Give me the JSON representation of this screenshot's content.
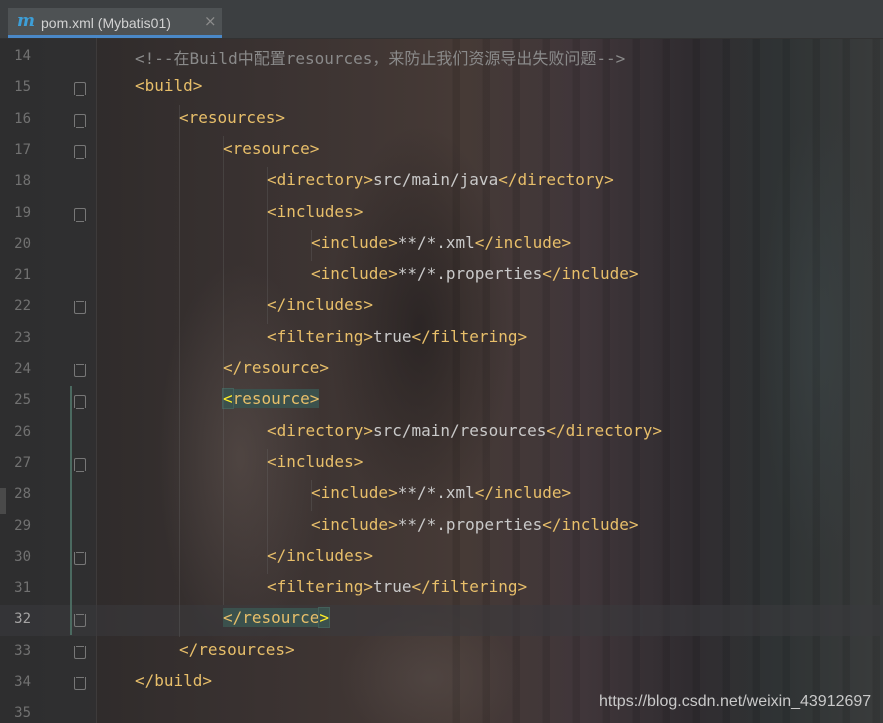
{
  "tab": {
    "icon": "m",
    "title": "pom.xml (Mybatis01)",
    "close": "×"
  },
  "editor": {
    "current_line": 32,
    "lines": [
      {
        "num": "14",
        "indent": 1,
        "parts": [
          {
            "t": "comment",
            "s": "<!--在Build中配置resources，来防止我们资源导出失败问题-->"
          }
        ]
      },
      {
        "num": "15",
        "indent": 1,
        "fold": "start",
        "parts": [
          {
            "t": "tag",
            "s": "<build>"
          }
        ]
      },
      {
        "num": "16",
        "indent": 2,
        "fold": "start",
        "parts": [
          {
            "t": "tag",
            "s": "<resources>"
          }
        ]
      },
      {
        "num": "17",
        "indent": 3,
        "fold": "start",
        "parts": [
          {
            "t": "tag",
            "s": "<resource>"
          }
        ]
      },
      {
        "num": "18",
        "indent": 4,
        "parts": [
          {
            "t": "tag",
            "s": "<directory>"
          },
          {
            "t": "text",
            "s": "src/main/java"
          },
          {
            "t": "tag",
            "s": "</directory>"
          }
        ]
      },
      {
        "num": "19",
        "indent": 4,
        "fold": "start",
        "parts": [
          {
            "t": "tag",
            "s": "<includes>"
          }
        ]
      },
      {
        "num": "20",
        "indent": 5,
        "parts": [
          {
            "t": "tag",
            "s": "<include>"
          },
          {
            "t": "text",
            "s": "**/*.xml"
          },
          {
            "t": "tag",
            "s": "</include>"
          }
        ]
      },
      {
        "num": "21",
        "indent": 5,
        "parts": [
          {
            "t": "tag",
            "s": "<include>"
          },
          {
            "t": "text",
            "s": "**/*.properties"
          },
          {
            "t": "tag",
            "s": "</include>"
          }
        ]
      },
      {
        "num": "22",
        "indent": 4,
        "fold": "end",
        "parts": [
          {
            "t": "tag",
            "s": "</includes>"
          }
        ]
      },
      {
        "num": "23",
        "indent": 4,
        "parts": [
          {
            "t": "tag",
            "s": "<filtering>"
          },
          {
            "t": "text",
            "s": "true"
          },
          {
            "t": "tag",
            "s": "</filtering>"
          }
        ]
      },
      {
        "num": "24",
        "indent": 3,
        "fold": "end",
        "parts": [
          {
            "t": "tag",
            "s": "</resource>"
          }
        ]
      },
      {
        "num": "25",
        "indent": 3,
        "fold": "start",
        "parts": [
          {
            "t": "match",
            "s": "<"
          },
          {
            "t": "matchtag",
            "s": "resource>"
          }
        ]
      },
      {
        "num": "26",
        "indent": 4,
        "parts": [
          {
            "t": "tag",
            "s": "<directory>"
          },
          {
            "t": "text",
            "s": "src/main/resources"
          },
          {
            "t": "tag",
            "s": "</directory>"
          }
        ]
      },
      {
        "num": "27",
        "indent": 4,
        "fold": "start",
        "parts": [
          {
            "t": "tag",
            "s": "<includes>"
          }
        ]
      },
      {
        "num": "28",
        "indent": 5,
        "parts": [
          {
            "t": "tag",
            "s": "<include>"
          },
          {
            "t": "text",
            "s": "**/*.xml"
          },
          {
            "t": "tag",
            "s": "</include>"
          }
        ]
      },
      {
        "num": "29",
        "indent": 5,
        "parts": [
          {
            "t": "tag",
            "s": "<include>"
          },
          {
            "t": "text",
            "s": "**/*.properties"
          },
          {
            "t": "tag",
            "s": "</include>"
          }
        ]
      },
      {
        "num": "30",
        "indent": 4,
        "fold": "end",
        "parts": [
          {
            "t": "tag",
            "s": "</includes>"
          }
        ]
      },
      {
        "num": "31",
        "indent": 4,
        "parts": [
          {
            "t": "tag",
            "s": "<filtering>"
          },
          {
            "t": "text",
            "s": "true"
          },
          {
            "t": "tag",
            "s": "</filtering>"
          }
        ]
      },
      {
        "num": "32",
        "indent": 3,
        "fold": "end",
        "parts": [
          {
            "t": "matchtag",
            "s": "</resource"
          },
          {
            "t": "match",
            "s": ">"
          }
        ]
      },
      {
        "num": "33",
        "indent": 2,
        "fold": "end",
        "parts": [
          {
            "t": "tag",
            "s": "</resources>"
          }
        ]
      },
      {
        "num": "34",
        "indent": 1,
        "fold": "end",
        "parts": [
          {
            "t": "tag",
            "s": "</build>"
          }
        ]
      },
      {
        "num": "35",
        "indent": 0,
        "parts": []
      }
    ]
  },
  "watermark": "https://blog.csdn.net/weixin_43912697",
  "colors": {
    "tag": "#e8bf6a",
    "text": "#c9c9c9",
    "comment": "#8a8a8a",
    "brace_match_bg": "#3b514d",
    "brace_match_fg": "#ffef28"
  }
}
